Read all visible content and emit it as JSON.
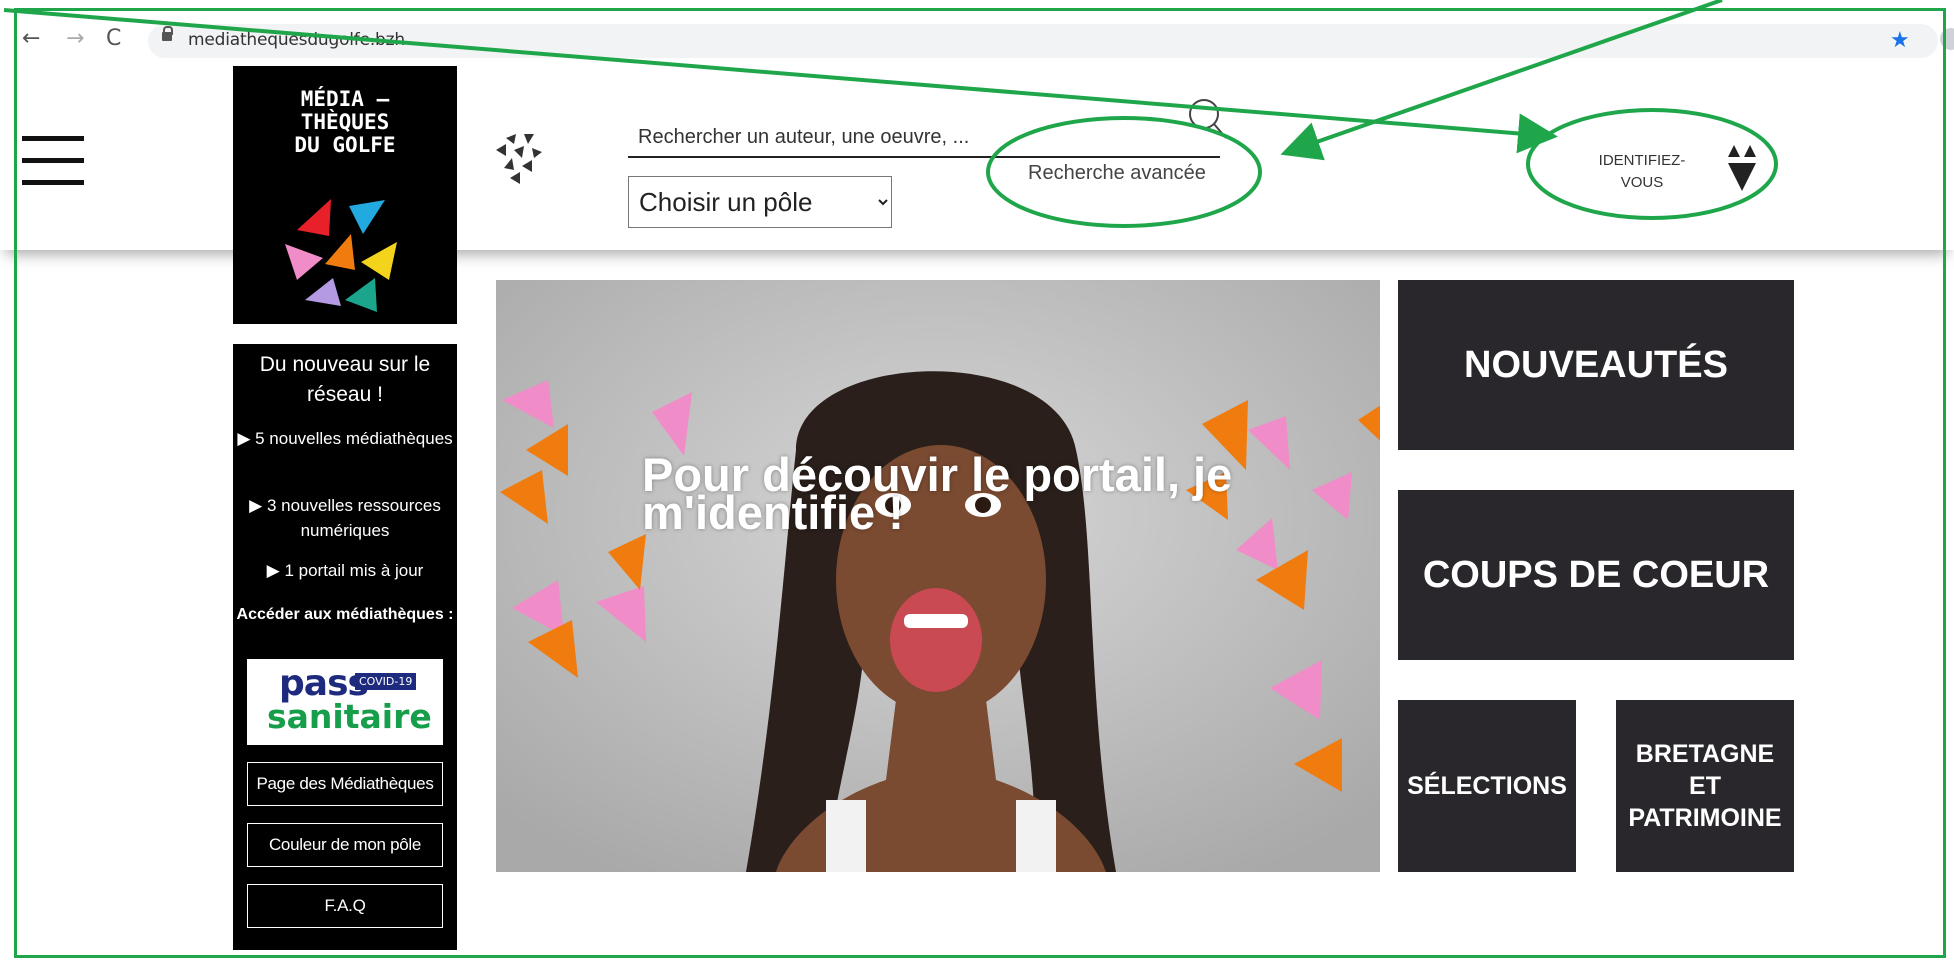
{
  "browser": {
    "url": "mediathequesdugolfe.bzh"
  },
  "header": {
    "logo_text": "MÉDIA —\nTHÈQUES\nDU GOLFE",
    "search_placeholder": "Rechercher un auteur, une oeuvre, ...",
    "advanced_search_label": "Recherche avancée",
    "pole_select_value": "Choisir un pôle",
    "login_label_line1": "IDENTIFIEZ-",
    "login_label_line2": "VOUS"
  },
  "sidebar": {
    "title": "Du nouveau sur le réseau !",
    "items": [
      "▶ 5 nouvelles médiathèques",
      "▶ 3 nouvelles ressources numériques",
      "▶ 1 portail mis à jour"
    ],
    "access_label": "Accéder aux médiathèques :",
    "pass_line1": "pass",
    "pass_badge": "COVID-19",
    "pass_line2": "sanitaire",
    "buttons": [
      "Page des Médiathèques",
      "Couleur de mon pôle",
      "F.A.Q"
    ]
  },
  "hero": {
    "caption": "Pour découvir le portail, je m'identifie !"
  },
  "tiles": {
    "nouveautes": "NOUVEAUTÉS",
    "coups_de_coeur": "COUPS DE COEUR",
    "selections": "SÉLECTIONS",
    "bretagne": "BRETAGNE ET PATRIMOINE"
  },
  "colors": {
    "annotation_green": "#1fa64a",
    "tile_bg": "#29272b",
    "sidebar_bg": "#000000"
  }
}
